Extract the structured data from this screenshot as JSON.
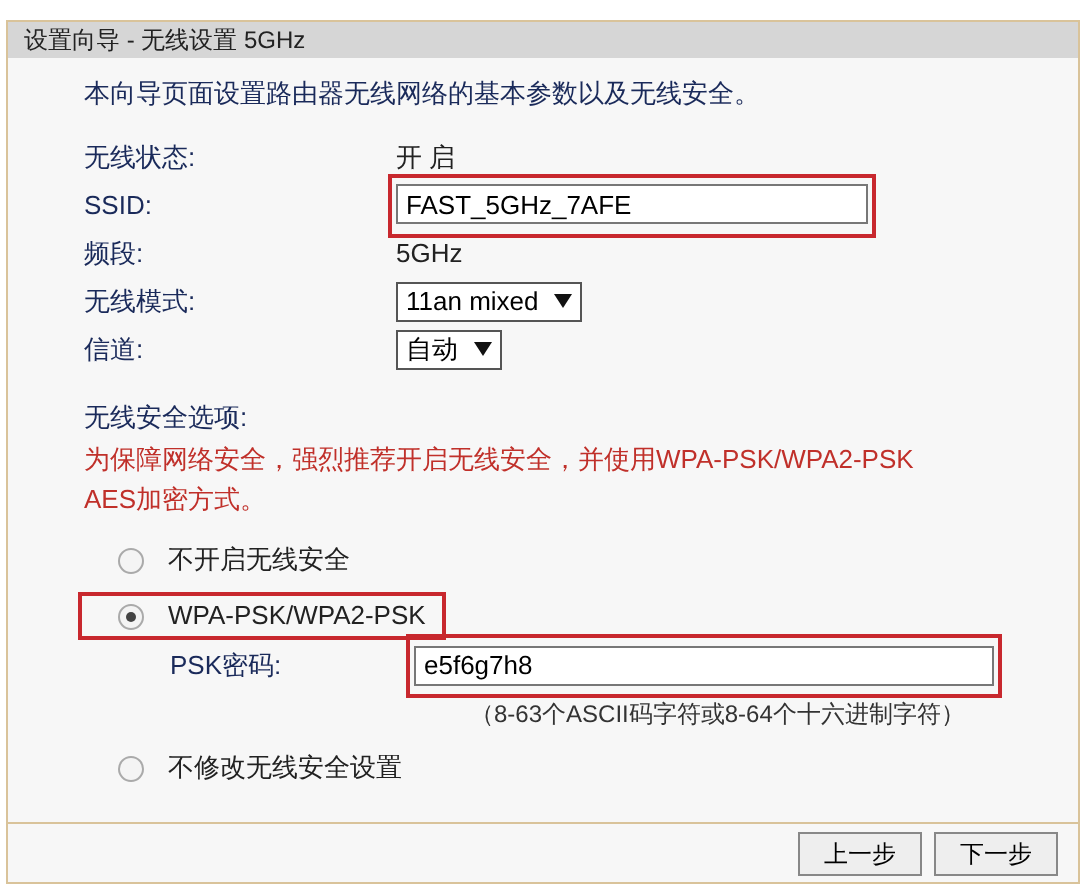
{
  "title": "设置向导 - 无线设置 5GHz",
  "intro": "本向导页面设置路由器无线网络的基本参数以及无线安全。",
  "fields": [
    {
      "kind": "text",
      "label": "无线状态:",
      "value": "开 启"
    },
    {
      "kind": "input",
      "label": "SSID:",
      "value": "FAST_5GHz_7AFE",
      "highlighted": true
    },
    {
      "kind": "text",
      "label": "频段:",
      "value": "5GHz"
    },
    {
      "kind": "select",
      "label": "无线模式:",
      "value": "11an mixed"
    },
    {
      "kind": "select",
      "label": "信道:",
      "value": "自动"
    }
  ],
  "security": {
    "heading": "无线安全选项:",
    "warning": "为保障网络安全，强烈推荐开启无线安全，并使用WPA-PSK/WPA2-PSK AES加密方式。",
    "options": [
      {
        "label": "不开启无线安全",
        "selected": false,
        "highlighted": false
      },
      {
        "label": "WPA-PSK/WPA2-PSK",
        "selected": true,
        "highlighted": true,
        "psk": {
          "label": "PSK密码:",
          "value": "e5f6g7h8",
          "highlighted": true,
          "hint": "（8-63个ASCII码字符或8-64个十六进制字符）"
        }
      },
      {
        "label": "不修改无线安全设置",
        "selected": false,
        "highlighted": false
      }
    ]
  },
  "buttons": [
    "上一步",
    "下一步"
  ]
}
